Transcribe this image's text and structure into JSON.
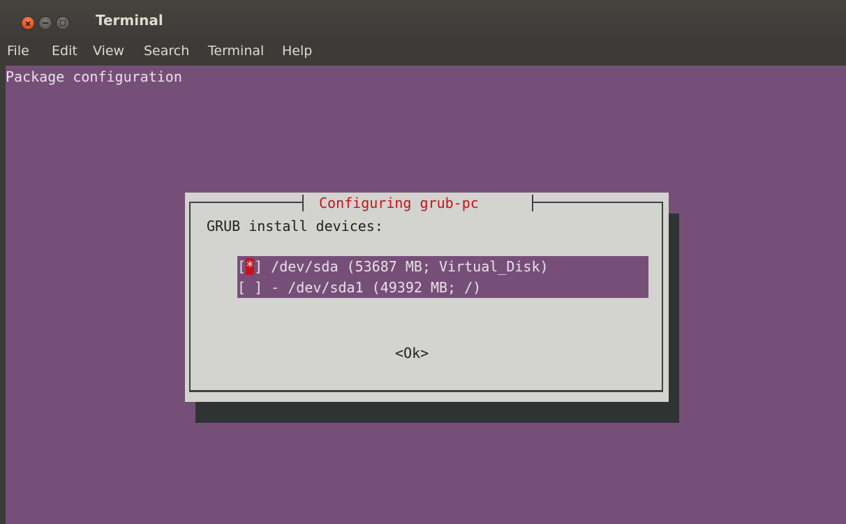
{
  "window": {
    "title": "Terminal"
  },
  "menu": {
    "items": [
      "File",
      "Edit",
      "View",
      "Search",
      "Terminal",
      "Help"
    ]
  },
  "terminal": {
    "heading": "Package configuration",
    "background_color": "#764f79"
  },
  "dialog": {
    "title": "Configuring grub-pc",
    "prompt": "GRUB install devices:",
    "options": [
      {
        "checkbox_open": "[",
        "mark": "*",
        "checkbox_close": "]",
        "label": " /dev/sda (53687 MB; Virtual_Disk)",
        "checked": true
      },
      {
        "checkbox": "[ ]",
        "label": " - /dev/sda1 (49392 MB; /)",
        "checked": false
      }
    ],
    "ok_label": "<Ok>",
    "title_color": "#c3141a",
    "background_color": "#d3d3cf"
  }
}
